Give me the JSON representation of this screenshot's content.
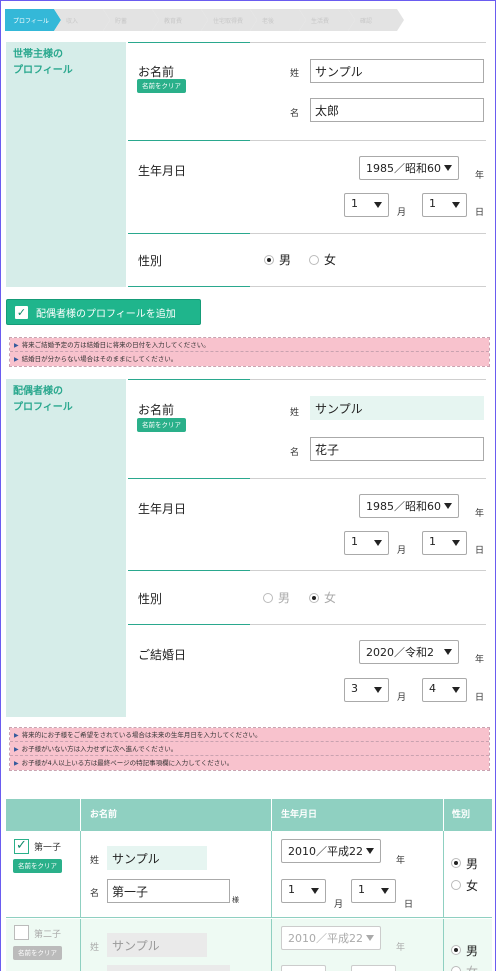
{
  "steps": [
    "プロフィール",
    "収入",
    "貯蓄",
    "教育費",
    "住宅取得費",
    "老後",
    "生活費",
    "確認"
  ],
  "household": {
    "section_label_line1": "世帯主様の",
    "section_label_line2": "プロフィール",
    "name_title": "お名前",
    "clear_label": "名前をクリア",
    "sei_label": "姓",
    "mei_label": "名",
    "sei_value": "サンプル",
    "mei_value": "太郎",
    "birth_title": "生年月日",
    "birth_year": "1985／昭和60",
    "birth_month": "1",
    "birth_day": "1",
    "unit_year": "年",
    "unit_month": "月",
    "unit_day": "日",
    "gender_title": "性別",
    "male": "男",
    "female": "女",
    "gender_selected": "男"
  },
  "add_spouse_button": "配偶者様のプロフィールを追加",
  "notes1": [
    "将来ご結婚予定の方は結婚日に将来の日付を入力してください。",
    "結婚日が分からない場合はそのままにしてください。"
  ],
  "spouse": {
    "section_label_line1": "配偶者様の",
    "section_label_line2": "プロフィール",
    "name_title": "お名前",
    "clear_label": "名前をクリア",
    "sei_label": "姓",
    "mei_label": "名",
    "sei_value": "サンプル",
    "mei_value": "花子",
    "birth_title": "生年月日",
    "birth_year": "1985／昭和60",
    "birth_month": "1",
    "birth_day": "1",
    "unit_year": "年",
    "unit_month": "月",
    "unit_day": "日",
    "gender_title": "性別",
    "male": "男",
    "female": "女",
    "gender_selected": "女",
    "marriage_title": "ご結婚日",
    "marriage_year": "2020／令和2",
    "marriage_month": "3",
    "marriage_day": "4"
  },
  "notes2": [
    "将来的にお子様をご希望をされている場合は未来の生年月日を入力してください。",
    "お子様がいない方は入力せずに次へ進んでください。",
    "お子様が4人以上いる方は最終ページの特記事項欄に入力してください。"
  ],
  "children_table": {
    "headers": [
      "",
      "お名前",
      "生年月日",
      "性別"
    ],
    "rows": [
      {
        "label": "第一子",
        "checked": true,
        "clear_label": "名前をクリア",
        "sei_label": "姓",
        "mei_label": "名",
        "sei_value": "サンプル",
        "mei_value": "第一子",
        "honorific": "様",
        "birth_year": "2010／平成22",
        "birth_month": "1",
        "birth_day": "1",
        "unit_year": "年",
        "unit_month": "月",
        "unit_day": "日",
        "male": "男",
        "female": "女",
        "gender_selected": "男"
      },
      {
        "label": "第二子",
        "checked": false,
        "clear_label": "名前をクリア",
        "sei_label": "姓",
        "sei_value": "サンプル",
        "birth_year": "2010／平成22",
        "unit_year": "年",
        "male": "男",
        "female": "女",
        "gender_selected": "男"
      }
    ]
  },
  "colors": {
    "accent": "#2aa88e",
    "label_bg": "#d6ede9",
    "step_active": "#34b8d8",
    "note_bg": "#f8c2cd",
    "table_header": "#8fd0c1",
    "button": "#1fb58c"
  }
}
